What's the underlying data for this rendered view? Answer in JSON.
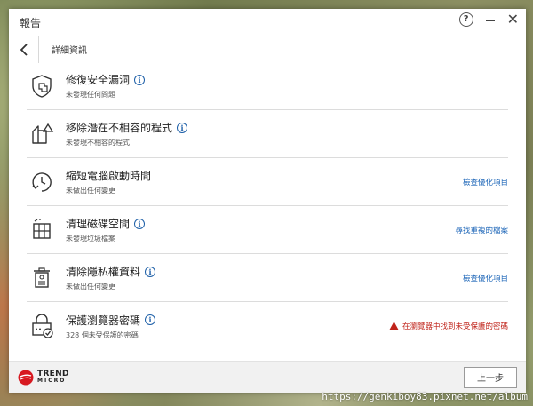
{
  "window": {
    "title": "報告"
  },
  "nav": {
    "breadcrumb": "詳細資訊"
  },
  "items": [
    {
      "name": "修復安全漏洞",
      "status": "未發現任何問題",
      "action": "",
      "icon": "shield-repair-icon"
    },
    {
      "name": "移除潛在不相容的程式",
      "status": "未發現不相容的程式",
      "action": "",
      "icon": "remove-program-icon"
    },
    {
      "name": "縮短電腦啟動時間",
      "status": "未做出任何變更",
      "action": "檢查優化項目",
      "icon": "startup-clock-icon"
    },
    {
      "name": "清理磁碟空間",
      "status": "未發現垃圾檔案",
      "action": "尋找重複的檔案",
      "icon": "disk-cleanup-icon"
    },
    {
      "name": "清除隱私權資料",
      "status": "未做出任何變更",
      "action": "檢查優化項目",
      "icon": "privacy-trash-icon"
    },
    {
      "name": "保護瀏覽器密碼",
      "status": "328 個未受保護的密碼",
      "warning": "在瀏覽器中找到未受保護的密碼",
      "icon": "password-lock-icon"
    }
  ],
  "footer": {
    "logo_line1": "TREND",
    "logo_line2": "MICRO",
    "prev_label": "上一步"
  },
  "watermark": "https://genkiboy83.pixnet.net/album",
  "colors": {
    "link": "#1d66b8",
    "warning": "#c0241b",
    "info": "#1d5fa8",
    "brand_red": "#d71920"
  }
}
